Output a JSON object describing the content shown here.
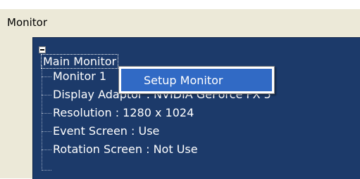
{
  "group": {
    "title": "Monitor"
  },
  "tree": {
    "root": {
      "label": "Main Monitor",
      "expanded": true
    },
    "children": [
      {
        "label": "Monitor 1"
      },
      {
        "label": "Display Adaptor : NVIDIA GeForce FX 5"
      },
      {
        "label": "Resolution : 1280 x 1024"
      },
      {
        "label": "Event Screen : Use"
      },
      {
        "label": "Rotation Screen : Not Use"
      }
    ]
  },
  "context_menu": {
    "items": [
      {
        "label": "Setup Monitor",
        "highlighted": true
      }
    ]
  },
  "colors": {
    "tree_background": "#1c3a6a",
    "menu_highlight": "#316ac5",
    "panel_background": "#ece9d8"
  }
}
